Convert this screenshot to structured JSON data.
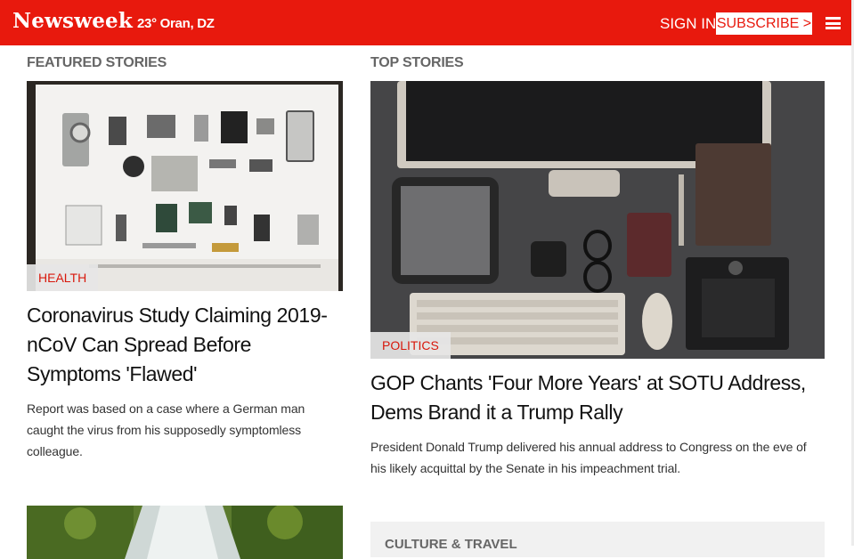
{
  "header": {
    "logo": "Newsweek",
    "weather": "23° Oran, DZ",
    "sign_in": "SIGN IN",
    "subscribe": "SUBSCRIBE >",
    "menu_icon": "hamburger-menu-icon"
  },
  "featured": {
    "section_label": "FEATURED STORIES",
    "tag": "HEALTH",
    "headline": "Coronavirus Study Claiming 2019-nCoV Can Spread Before Symptoms 'Flawed'",
    "summary": "Report was based on a case where a German man caught the virus from his supposedly symptomless colleague."
  },
  "top": {
    "section_label": "TOP STORIES",
    "tag": "POLITICS",
    "headline": "GOP Chants 'Four More Years' at SOTU Address, Dems Brand it a Trump Rally",
    "summary": "President Donald Trump delivered his annual address to Congress on the eve of his likely acquittal by the Senate in his impeachment trial."
  },
  "culture": {
    "section_label": "CULTURE & TRAVEL"
  },
  "colors": {
    "brand_red": "#e8190d",
    "tag_text": "#d8180c"
  }
}
